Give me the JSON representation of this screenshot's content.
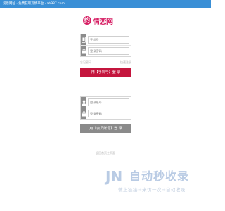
{
  "header": {
    "text": "爱意网址 · 免费获取友情平台 · ah987.com"
  },
  "logo": {
    "mark": "约",
    "text": "情恋网"
  },
  "phone_login": {
    "phone_placeholder": "手机号",
    "password_placeholder": "登录密码",
    "forgot_link": "忘记密码",
    "register_link": "快速注册",
    "button_label": "用【手机号】登 录"
  },
  "account_login": {
    "account_placeholder": "登录账号",
    "password_placeholder": "登录密码",
    "button_label": "用【会员账号】登 录"
  },
  "footer": {
    "link_text": "返回首页主页面"
  },
  "watermark": {
    "mark": "JN",
    "title": "自动秒收录",
    "subtitle": "做上链接→来访一次→自动收录"
  },
  "colors": {
    "primary": "#c4153d",
    "secondary_button": "#8a8a8a",
    "brand": "#d61e63",
    "topbar": "#3a8fd6"
  }
}
